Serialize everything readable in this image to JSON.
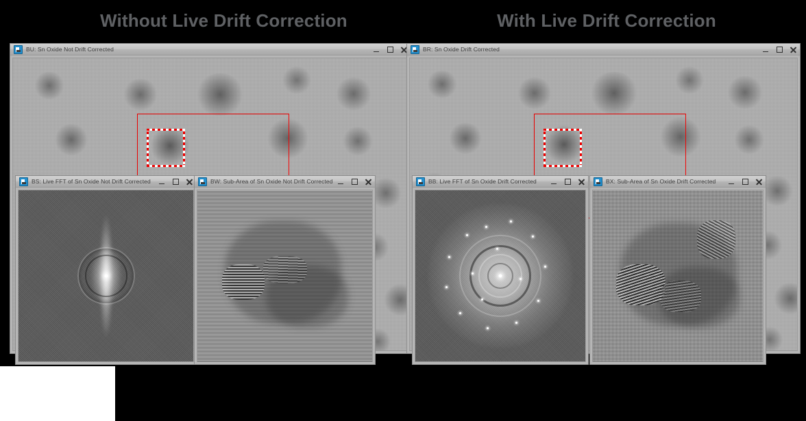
{
  "page": {
    "background_color": "#000000",
    "heading_color": "#5f6164",
    "overlay_color": "#ee0000"
  },
  "headings": {
    "left": "Without Live Drift Correction",
    "right": "With Live Drift Correction"
  },
  "window_controls": {
    "minimize": "minimize",
    "maximize": "maximize",
    "close": "close",
    "icon": "document-image-icon"
  },
  "windows": [
    {
      "id": "BU",
      "title": "BU: Sn Oxide Not Drift Corrected",
      "role": "main-micrograph-uncorrected",
      "side": "left"
    },
    {
      "id": "BS",
      "title": "BS: Live FFT of Sn Oxide Not Drift Corrected",
      "role": "live-fft-uncorrected",
      "side": "left"
    },
    {
      "id": "BW",
      "title": "BW: Sub-Area of Sn Oxide Not Drift Corrected",
      "role": "sub-area-uncorrected",
      "side": "left"
    },
    {
      "id": "BR",
      "title": "BR: Sn Oxide Drift Corrected",
      "role": "main-micrograph-corrected",
      "side": "right"
    },
    {
      "id": "BB",
      "title": "BB: Live FFT of Sn Oxide Drift Corrected",
      "role": "live-fft-corrected",
      "side": "right"
    },
    {
      "id": "BX",
      "title": "BX: Sub-Area of Sn Oxide Drift Corrected",
      "role": "sub-area-corrected",
      "side": "right"
    }
  ],
  "overlays": {
    "fov_box_label": "field-of-view-box",
    "roi_box_label": "sub-area-selection-box"
  }
}
